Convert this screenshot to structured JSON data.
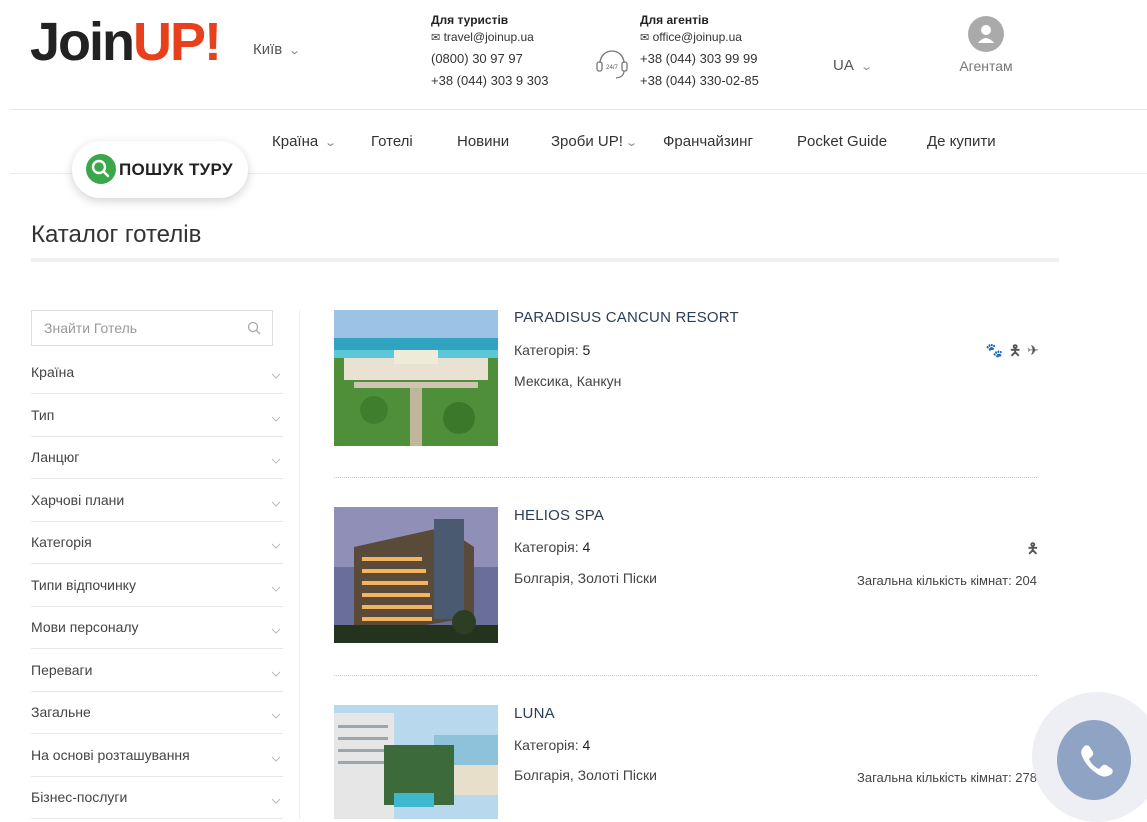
{
  "header": {
    "logo": {
      "join": "Join",
      "up": "UP",
      "ex": "!"
    },
    "city": "Київ",
    "tourists": {
      "title": "Для туристів",
      "email": "travel@joinup.ua",
      "phone1": "(0800) 30 97 97",
      "phone2": "+38 (044) 303 9 303"
    },
    "agents": {
      "title": "Для агентів",
      "email": "office@joinup.ua",
      "phone1": "+38 (044) 303 99 99",
      "phone2": "+38 (044) 330-02-85"
    },
    "badge247": "24/7",
    "lang": "UA",
    "agent_label": "Агентам"
  },
  "nav": {
    "items": [
      "Країна",
      "Готелі",
      "Новини",
      "Зроби UP!",
      "Франчайзинг",
      "Pocket Guide",
      "Де купити"
    ],
    "search_tour": "ПОШУК ТУРУ"
  },
  "page_title": "Каталог готелів",
  "sidebar": {
    "search_placeholder": "Знайти Готель",
    "filters": [
      "Країна",
      "Тип",
      "Ланцюг",
      "Харчові плани",
      "Категорія",
      "Типи відпочинку",
      "Мови персоналу",
      "Переваги",
      "Загальне",
      "На основі розташування",
      "Бізнес-послуги"
    ]
  },
  "hotels": [
    {
      "name": "PARADISUS CANCUN RESORT",
      "category_label": "Категорія:",
      "category": "5",
      "location": "Мексика, Канкун",
      "rooms": "",
      "amenities": [
        "paw-icon",
        "child-icon",
        "plane-icon"
      ]
    },
    {
      "name": "HELIOS SPA",
      "category_label": "Категорія:",
      "category": "4",
      "location": "Болгарія, Золоті Піски",
      "rooms": "Загальна кількість кімнат: 204",
      "amenities": [
        "child-icon"
      ]
    },
    {
      "name": "LUNA",
      "category_label": "Категорія:",
      "category": "4",
      "location": "Болгарія, Золоті Піски",
      "rooms": "Загальна кількість кімнат: 278",
      "amenities": []
    }
  ],
  "colors": {
    "accent": "#e8401c",
    "search_green": "#3aa84a",
    "call_button": "#8fa3c4",
    "hotel_name": "#2b3e55"
  }
}
